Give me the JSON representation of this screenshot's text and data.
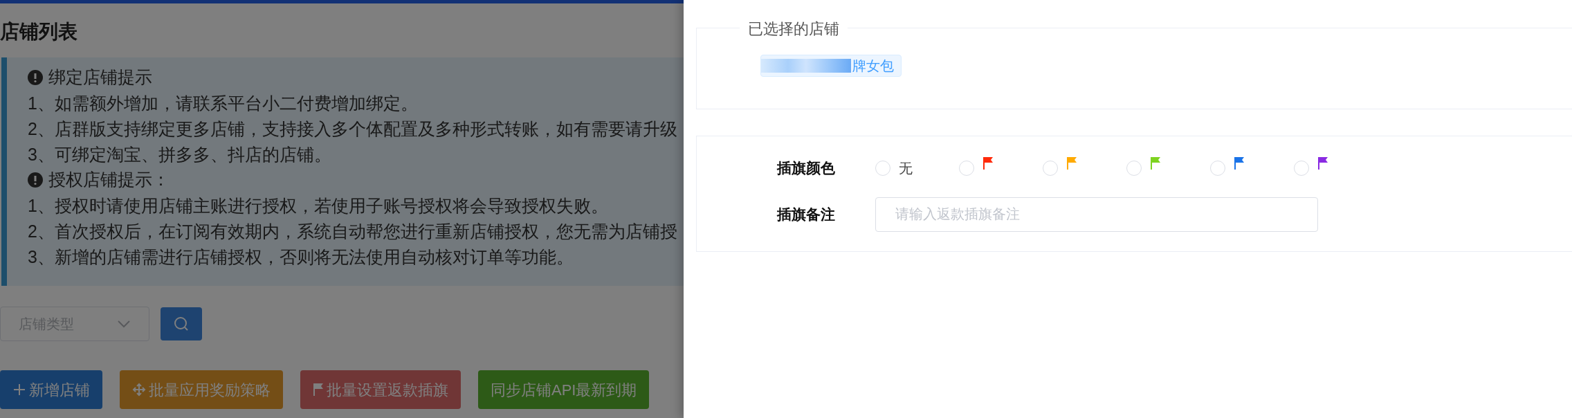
{
  "page": {
    "title": "店铺列表",
    "notice": {
      "sections": [
        {
          "heading": "绑定店铺提示",
          "lines": [
            "1、如需额外增加，请联系平台小二付费增加绑定。",
            "2、店群版支持绑定更多店铺，支持接入多个体配置及多种形式转账，如有需要请升级",
            "3、可绑定淘宝、拼多多、抖店的店铺。"
          ]
        },
        {
          "heading": "授权店铺提示：",
          "lines": [
            "1、授权时请使用店铺主账进行授权，若使用子账号授权将会导致授权失败。",
            "2、首次授权后，在订阅有效期内，系统自动帮您进行重新店铺授权，您无需为店铺授",
            "3、新增的店铺需进行店铺授权，否则将无法使用自动核对订单等功能。"
          ]
        }
      ]
    },
    "filter": {
      "placeholder": "店铺类型"
    },
    "actions": [
      {
        "kind": "plus",
        "label": "新增店铺"
      },
      {
        "kind": "move",
        "label": "批量应用奖励策略"
      },
      {
        "kind": "flag",
        "label": "批量设置返款插旗"
      },
      {
        "kind": "sync",
        "label": "同步店铺API最新到期"
      }
    ]
  },
  "drawer": {
    "selected_stores": {
      "legend": "已选择的店铺",
      "tags": [
        "牌女包"
      ]
    },
    "flag_color": {
      "label": "插旗颜色",
      "options": [
        {
          "kind": "none",
          "label": "无",
          "selected": false
        },
        {
          "kind": "flag",
          "color": "#ff2a0a",
          "selected": false
        },
        {
          "kind": "flag",
          "color": "#ffaa00",
          "selected": false
        },
        {
          "kind": "flag",
          "color": "#7ed321",
          "selected": false
        },
        {
          "kind": "flag",
          "color": "#1a73e8",
          "selected": false
        },
        {
          "kind": "flag",
          "color": "#8a2be2",
          "selected": false
        }
      ]
    },
    "flag_note": {
      "label": "插旗备注",
      "placeholder": "请输入返款插旗备注"
    }
  }
}
